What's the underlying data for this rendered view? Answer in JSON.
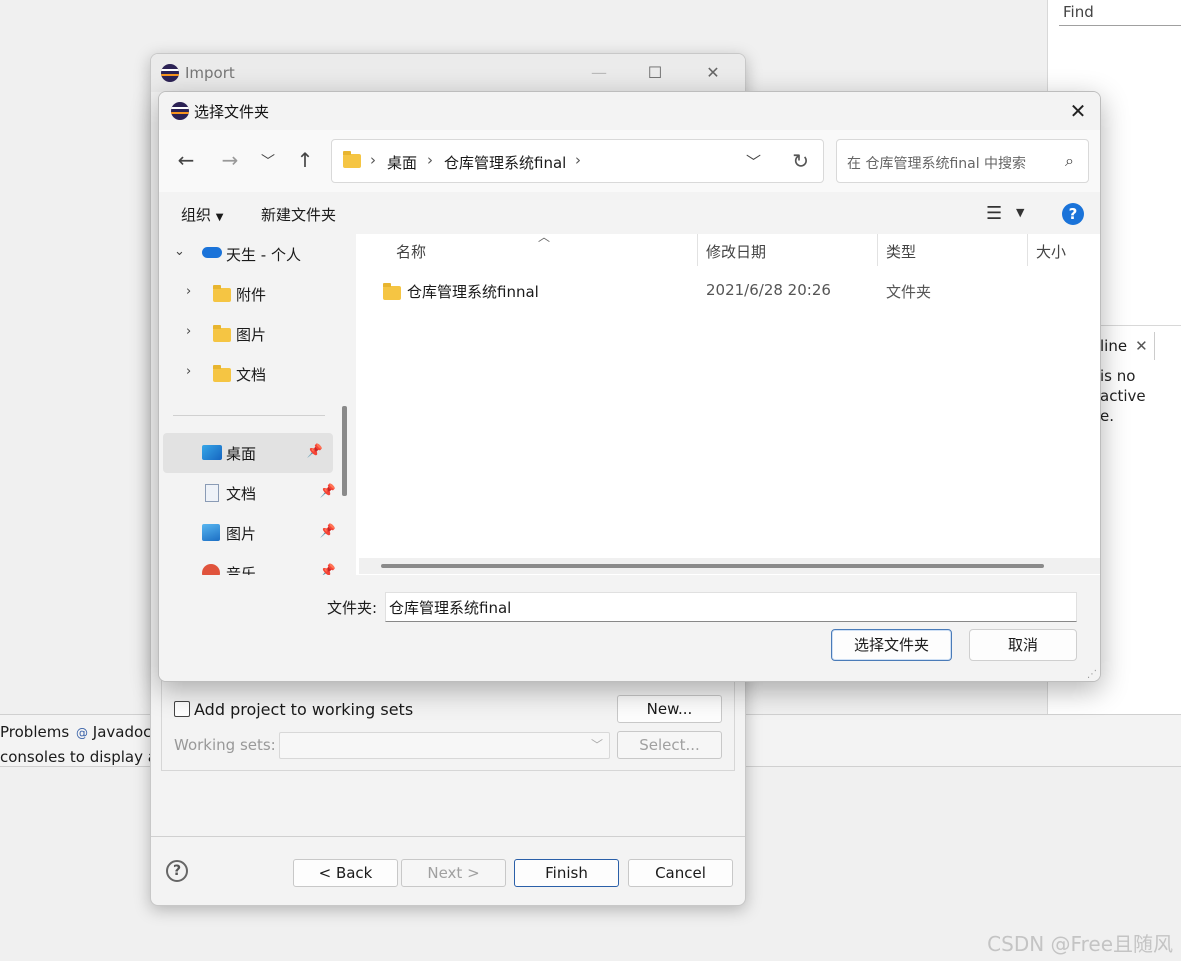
{
  "eclipse": {
    "find_placeholder": "Find",
    "outline_tab": "line",
    "outline_msg_1": "is no active",
    "outline_msg_2": "e.",
    "problems_tab": "Problems",
    "javadoc_tab": "Javadoc",
    "console_msg": "consoles to display at"
  },
  "import_dialog": {
    "title": "Import",
    "add_to_working_sets": "Add project to working sets",
    "new_button": "New...",
    "working_sets_label": "Working sets:",
    "select_button": "Select...",
    "back_button": "< Back",
    "next_button": "Next >",
    "finish_button": "Finish",
    "cancel_button": "Cancel"
  },
  "folder_picker": {
    "title": "选择文件夹",
    "breadcrumb": [
      "桌面",
      "仓库管理系统final"
    ],
    "search_placeholder": "在 仓库管理系统final 中搜索",
    "organize_label": "组织",
    "new_folder_label": "新建文件夹",
    "nav_items": [
      {
        "label": "天生 - 个人",
        "icon": "onedrive-icon"
      },
      {
        "label": "附件",
        "icon": "folder-icon"
      },
      {
        "label": "图片",
        "icon": "folder-icon"
      },
      {
        "label": "文档",
        "icon": "folder-icon"
      }
    ],
    "quick_access": [
      {
        "label": "桌面",
        "icon": "desktop-icon",
        "selected": true
      },
      {
        "label": "文档",
        "icon": "document-icon"
      },
      {
        "label": "图片",
        "icon": "pictures-icon"
      },
      {
        "label": "音乐",
        "icon": "music-icon"
      }
    ],
    "columns": [
      "名称",
      "修改日期",
      "类型",
      "大小"
    ],
    "files": [
      {
        "name": "仓库管理系统finnal",
        "modified": "2021/6/28 20:26",
        "type": "文件夹",
        "size": ""
      }
    ],
    "folder_label": "文件夹:",
    "folder_value": "仓库管理系统final",
    "select_folder_button": "选择文件夹",
    "cancel_button": "取消"
  },
  "watermark": "CSDN @Free且随风"
}
